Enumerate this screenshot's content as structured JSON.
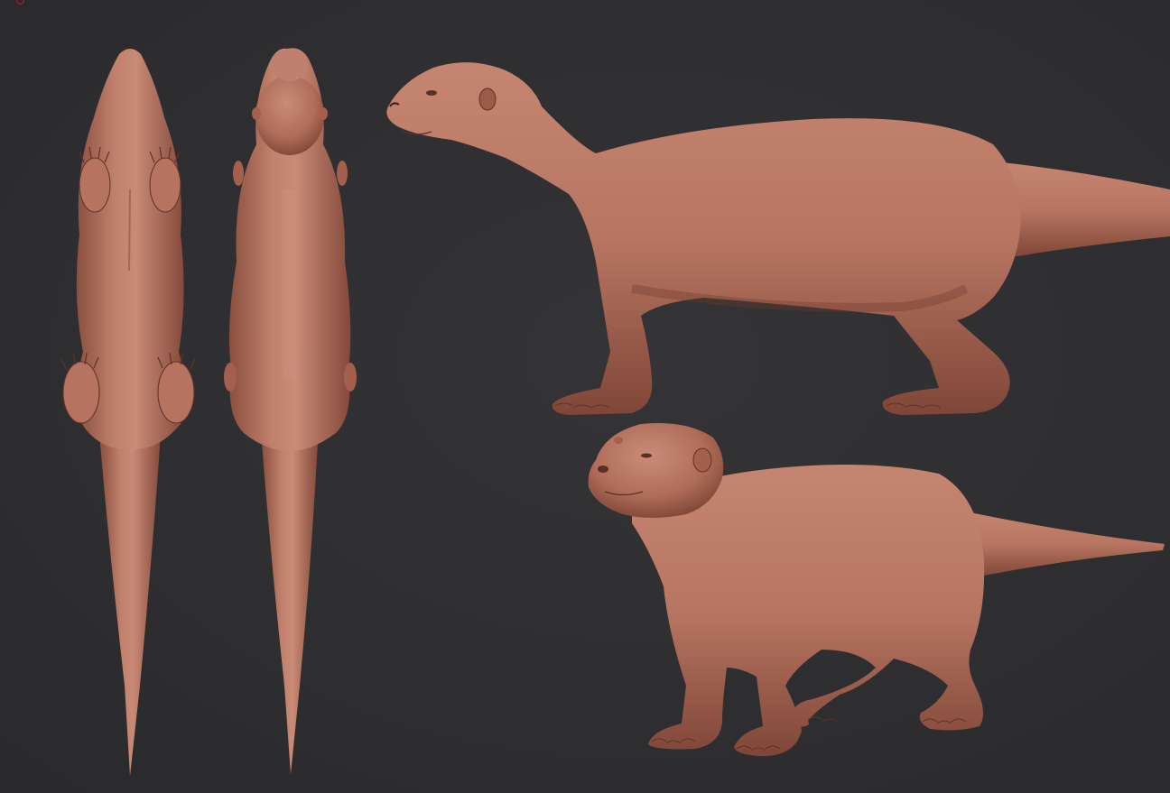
{
  "scene": {
    "background_color": "#2f2f31",
    "model_color": "#b57360",
    "model_highlight": "#c98a76",
    "model_shadow": "#7a4536",
    "marker_color": "#b3262a",
    "views": [
      {
        "name": "bottom-view"
      },
      {
        "name": "top-view"
      },
      {
        "name": "side-view"
      },
      {
        "name": "perspective-view"
      }
    ]
  }
}
